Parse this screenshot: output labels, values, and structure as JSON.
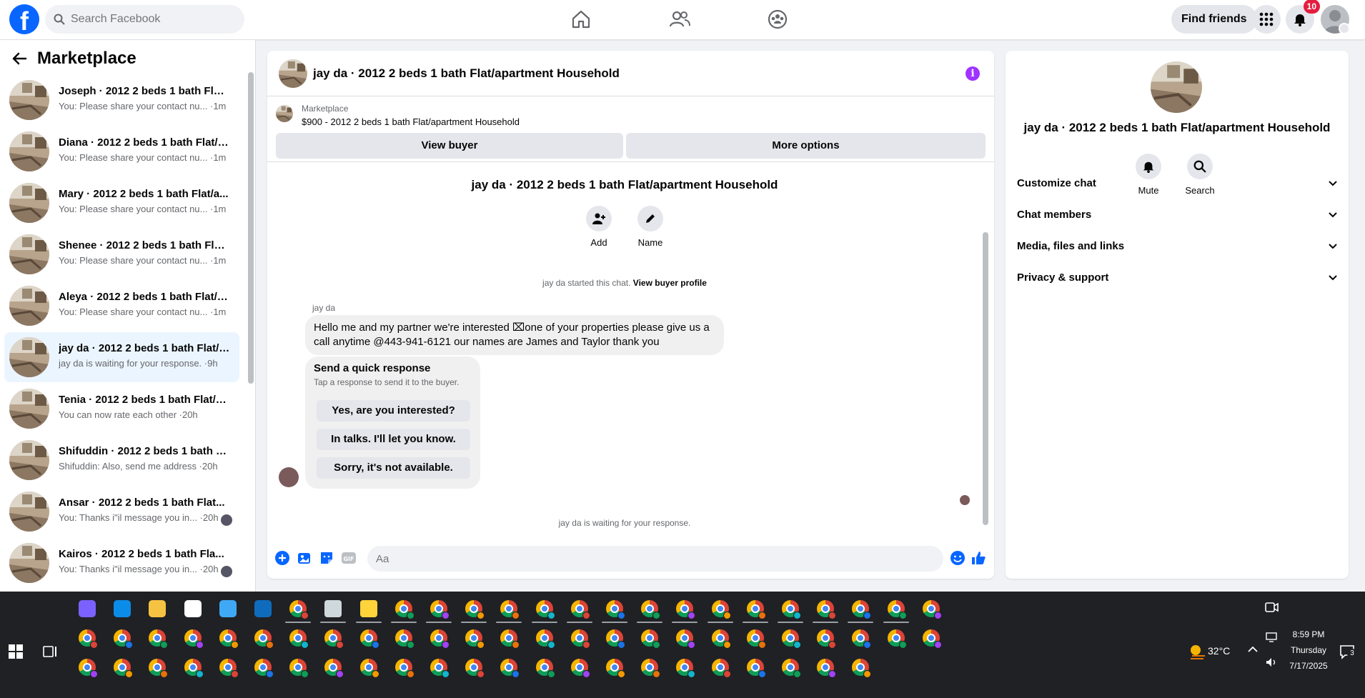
{
  "topbar": {
    "search_placeholder": "Search Facebook",
    "find_friends": "Find friends",
    "notification_count": "10",
    "brand_color": "#0866ff"
  },
  "sidebar": {
    "title": "Marketplace",
    "conversations": [
      {
        "name": "Joseph · 2012 2 beds 1 bath Flat/...",
        "snippet": "You: Please share your contact nu... ·1m"
      },
      {
        "name": "Diana · 2012 2 beds 1 bath Flat/a...",
        "snippet": "You: Please share your contact nu... ·1m"
      },
      {
        "name": "Mary · 2012 2 beds 1 bath Flat/a...",
        "snippet": "You: Please share your contact nu... ·1m"
      },
      {
        "name": "Shenee · 2012 2 beds 1 bath Flat...",
        "snippet": "You: Please share your contact nu... ·1m"
      },
      {
        "name": "Aleya · 2012 2 beds 1 bath Flat/a...",
        "snippet": "You: Please share your contact nu... ·1m"
      },
      {
        "name": "jay da · 2012 2 beds 1 bath Flat/a...",
        "snippet": "jay da is waiting for your response. ·9h"
      },
      {
        "name": "Tenia · 2012 2 beds 1 bath Flat/a...",
        "snippet": "You can now rate each other ·20h"
      },
      {
        "name": "Shifuddin · 2012 2 beds 1 bath Fl...",
        "snippet": "Shifuddin: Also, send me address ·20h"
      },
      {
        "name": "Ansar · 2012 2 beds 1 bath Flat...",
        "snippet": "You: Thanks i\"il message you in... ·20h"
      },
      {
        "name": "Kairos · 2012 2 beds 1 bath Fla...",
        "snippet": "You: Thanks i\"il message you in... ·20h"
      }
    ]
  },
  "chat": {
    "title": "jay da · 2012 2 beds 1 bath Flat/apartment Household",
    "marketplace_label": "Marketplace",
    "listing": "$900 - 2012 2 beds 1 bath Flat/apartment Household",
    "view_buyer": "View buyer",
    "more_options": "More options",
    "center_title": "jay da · 2012 2 beds 1 bath Flat/apartment Household",
    "add_label": "Add",
    "name_label": "Name",
    "started_text": "jay da started this chat.",
    "view_buyer_profile": "View buyer profile",
    "sender": "jay da",
    "message": "Hello me and my partner we're interested ⌧one of your properties please give us a call anytime @443-941-6121 our names are James and Taylor thank you",
    "quick_title": "Send a quick response",
    "quick_sub": "Tap a response to send it to the buyer.",
    "quick_responses": [
      "Yes, are you interested?",
      "In talks. I'll let you know.",
      "Sorry, it's not available."
    ],
    "waiting": "jay da is waiting for your response.",
    "input_placeholder": "Aa"
  },
  "info_panel": {
    "title": "jay da · 2012 2 beds 1 bath Flat/apartment Household",
    "mute": "Mute",
    "search": "Search",
    "sections": [
      "Customize chat",
      "Chat members",
      "Media, files and links",
      "Privacy & support"
    ]
  },
  "taskbar": {
    "temperature": "32°C",
    "time": "8:59 PM",
    "day": "Thursday",
    "date": "7/17/2025",
    "notif_count": "3"
  }
}
